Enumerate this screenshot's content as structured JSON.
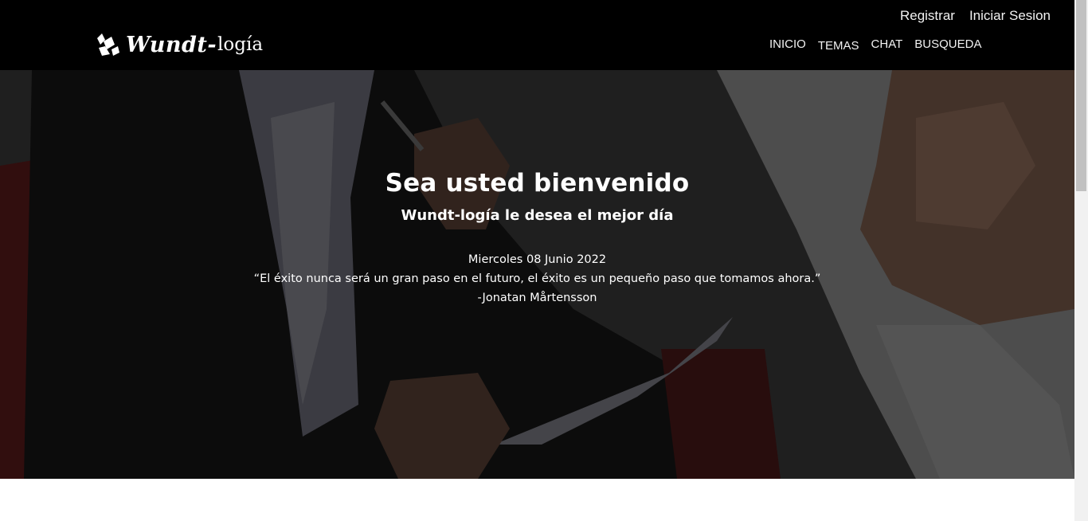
{
  "header": {
    "logo": {
      "bold": "Wundt-",
      "light": "logía"
    },
    "top_links": [
      {
        "label": "Registrar"
      },
      {
        "label": "Iniciar Sesion"
      }
    ],
    "nav": [
      {
        "label": "INICIO"
      },
      {
        "label": "TEMAS"
      },
      {
        "label": "CHAT"
      },
      {
        "label": "BUSQUEDA"
      }
    ]
  },
  "hero": {
    "title": "Sea usted bienvenido",
    "subtitle": "Wundt-logía le desea el mejor día",
    "date": "Miercoles 08 Junio 2022",
    "quote": "“El éxito nunca será un gran paso en el futuro, el éxito es un pequeño paso que tomamos ahora.”",
    "author": "-Jonatan Mårtensson"
  },
  "colors": {
    "header_bg": "#000000",
    "text": "#ffffff",
    "overlay": "#000000"
  }
}
